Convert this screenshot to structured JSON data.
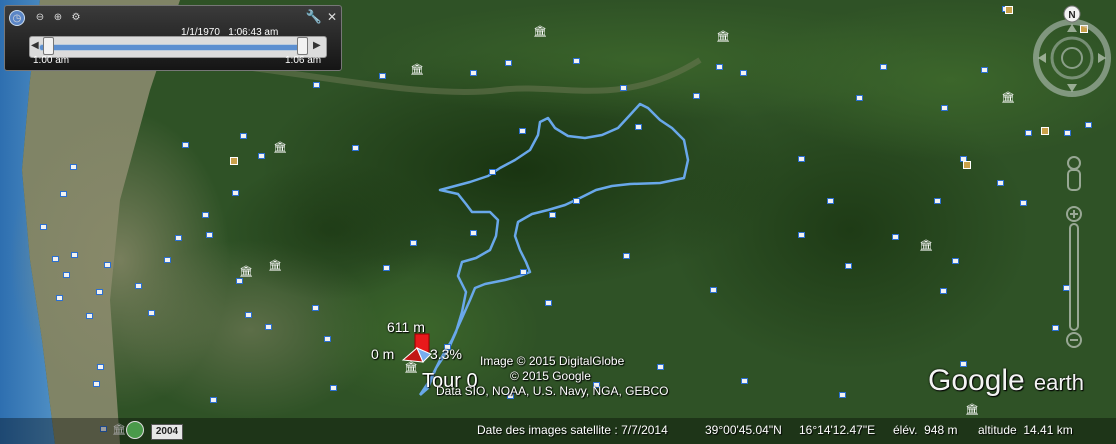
{
  "time_slider": {
    "date_time": "1/1/1970   1:06:43 am",
    "start_label": "1:00 am",
    "end_label": "1:06 am",
    "icons": [
      "clock-icon",
      "zoom-out-icon",
      "zoom-in-icon",
      "settings-icon",
      "wrench-icon",
      "close-icon"
    ]
  },
  "track": {
    "elevation_top": "611 m",
    "elevation_bottom": "0 m",
    "grade": "3.3%",
    "tour_label": "Tour 0",
    "track_color": "#69a8ea",
    "marker_color": "#e8191b"
  },
  "attribution": {
    "line1": "Image © 2015 DigitalGlobe",
    "line2": "© 2015 Google",
    "line3": "Data SIO, NOAA, U.S. Navy, NGA, GEBCO"
  },
  "logo": {
    "google": "Google",
    "earth": "earth"
  },
  "nav": {
    "north_label": "N"
  },
  "status": {
    "imagery_date": "Date des images satellite : 7/7/2014",
    "latitude": "39°00'45.04\"N",
    "longitude": "16°14'12.47\"E",
    "elevation": "élév.  948 m",
    "eye_altitude": "altitude  14.41 km",
    "year_badge": "2004"
  }
}
